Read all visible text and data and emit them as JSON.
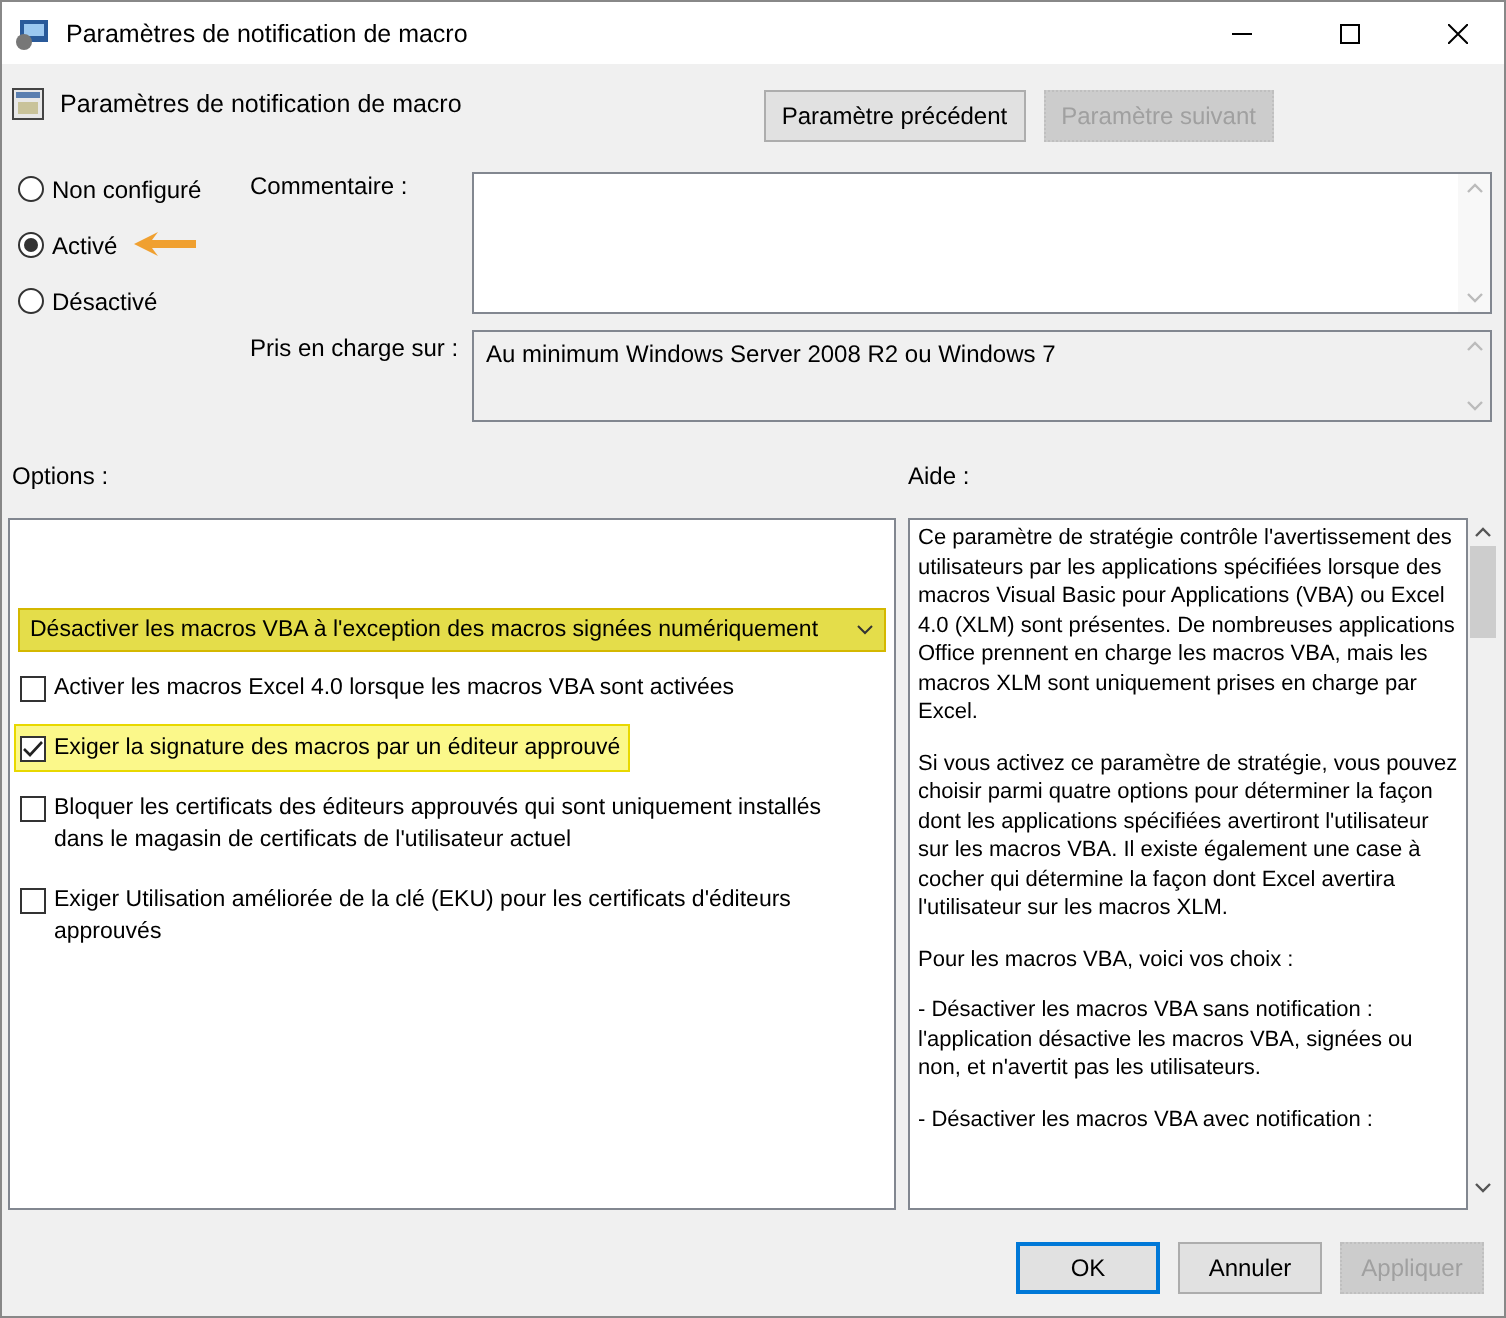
{
  "window": {
    "title": "Paramètres de notification de macro"
  },
  "header": {
    "title": "Paramètres de notification de macro",
    "buttons": [
      {
        "label": "Paramètre précédent",
        "disabled": false
      },
      {
        "label": "Paramètre suivant",
        "disabled": true
      }
    ]
  },
  "states": [
    {
      "label": "Non configuré",
      "selected": false,
      "pointer": false
    },
    {
      "label": "Activé",
      "selected": true,
      "pointer": true
    },
    {
      "label": "Désactivé",
      "selected": false,
      "pointer": false
    }
  ],
  "comment": {
    "label": "Commentaire :"
  },
  "supported": {
    "label": "Pris en charge sur :",
    "value": "Au minimum Windows Server 2008 R2 ou Windows 7"
  },
  "options": {
    "label": "Options :",
    "dropdown": {
      "value": "Désactiver les macros VBA à l'exception des macros signées numériquement",
      "highlighted": true
    },
    "checkboxes": [
      {
        "label": "Activer les macros Excel 4.0 lorsque les macros VBA sont activées",
        "checked": false,
        "highlighted": false
      },
      {
        "label": "Exiger la signature des macros par un éditeur approuvé",
        "checked": true,
        "highlighted": true
      },
      {
        "label": "Bloquer les certificats des éditeurs approuvés qui sont uniquement installés dans le magasin de certificats de l'utilisateur actuel",
        "checked": false,
        "highlighted": false
      },
      {
        "label": "Exiger Utilisation améliorée de la clé (EKU) pour les certificats d'éditeurs approuvés",
        "checked": false,
        "highlighted": false
      }
    ]
  },
  "help": {
    "label": "Aide :",
    "paragraphs": [
      "Ce paramètre de stratégie contrôle l'avertissement des utilisateurs par les applications spécifiées lorsque des macros Visual Basic pour Applications (VBA) ou Excel 4.0 (XLM) sont présentes. De nombreuses applications Office prennent en charge les macros VBA, mais les macros XLM sont uniquement prises en charge par Excel.",
      "Si vous activez ce paramètre de stratégie, vous pouvez choisir parmi quatre options pour déterminer la façon dont les applications spécifiées avertiront l'utilisateur sur les macros VBA. Il existe également une case à cocher qui détermine la façon dont Excel avertira l'utilisateur sur les macros XLM.",
      "Pour les macros VBA, voici vos choix :",
      "- Désactiver les macros VBA sans notification : l'application désactive les macros VBA, signées ou non, et n'avertit pas les utilisateurs.",
      "- Désactiver les macros VBA avec notification :"
    ]
  },
  "footer": {
    "buttons": [
      {
        "label": "OK",
        "disabled": false,
        "default": true
      },
      {
        "label": "Annuler",
        "disabled": false,
        "default": false
      },
      {
        "label": "Appliquer",
        "disabled": true,
        "default": false
      }
    ]
  }
}
